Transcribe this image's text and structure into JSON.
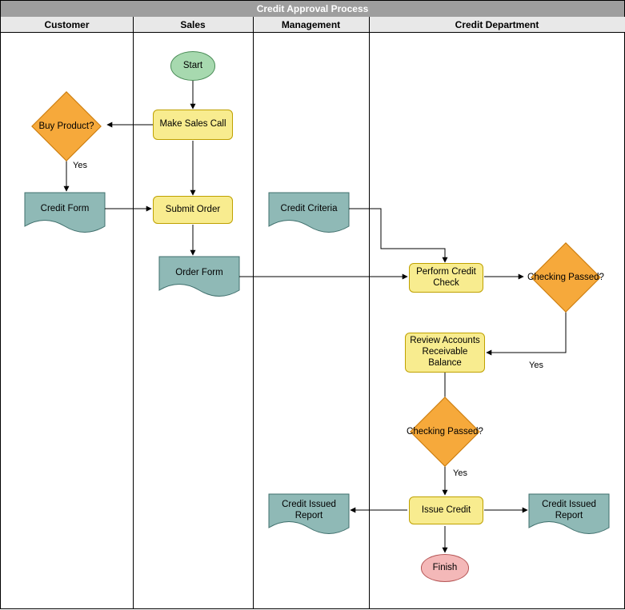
{
  "title": "Credit Approval Process",
  "lanes": {
    "customer": "Customer",
    "sales": "Sales",
    "management": "Management",
    "credit": "Credit Department"
  },
  "nodes": {
    "start": "Start",
    "make_sales_call": "Make Sales Call",
    "buy_product": "Buy Product?",
    "credit_form": "Credit Form",
    "submit_order": "Submit Order",
    "order_form": "Order Form",
    "credit_criteria": "Credit Criteria",
    "perform_credit_check": "Perform Credit Check",
    "checking_passed_1": "Checking Passed?",
    "review_ar_balance": "Review Accounts Receivable Balance",
    "checking_passed_2": "Checking Passed?",
    "issue_credit": "Issue Credit",
    "credit_issued_report_l": "Credit Issued Report",
    "credit_issued_report_r": "Credit Issued Report",
    "finish": "Finish"
  },
  "edge_labels": {
    "buy_yes": "Yes",
    "cp1_yes": "Yes",
    "cp2_yes": "Yes"
  },
  "colors": {
    "title_bg": "#9e9e9e",
    "lane_header_bg": "#e8e8e8",
    "process_fill": "#f8ec8f",
    "process_stroke": "#bfa100",
    "decision_fill": "#f6a93b",
    "decision_stroke": "#c97a0a",
    "document_fill": "#8fb9b6",
    "document_stroke": "#3f6f6c",
    "start_fill": "#a7d9af",
    "start_stroke": "#4a8c57",
    "finish_fill": "#f4b8b8",
    "finish_stroke": "#b55555"
  },
  "chart_data": {
    "type": "flowchart-swimlane",
    "swimlanes": [
      "Customer",
      "Sales",
      "Management",
      "Credit Department"
    ],
    "nodes": [
      {
        "id": "start",
        "lane": "Sales",
        "type": "start",
        "label": "Start"
      },
      {
        "id": "make_sales_call",
        "lane": "Sales",
        "type": "process",
        "label": "Make Sales Call"
      },
      {
        "id": "buy_product",
        "lane": "Customer",
        "type": "decision",
        "label": "Buy Product?"
      },
      {
        "id": "credit_form",
        "lane": "Customer",
        "type": "document",
        "label": "Credit Form"
      },
      {
        "id": "submit_order",
        "lane": "Sales",
        "type": "process",
        "label": "Submit Order"
      },
      {
        "id": "order_form",
        "lane": "Sales",
        "type": "document",
        "label": "Order Form"
      },
      {
        "id": "credit_criteria",
        "lane": "Management",
        "type": "document",
        "label": "Credit Criteria"
      },
      {
        "id": "perform_credit_check",
        "lane": "Credit Department",
        "type": "process",
        "label": "Perform Credit Check"
      },
      {
        "id": "checking_passed_1",
        "lane": "Credit Department",
        "type": "decision",
        "label": "Checking Passed?"
      },
      {
        "id": "review_ar_balance",
        "lane": "Credit Department",
        "type": "process",
        "label": "Review Accounts Receivable Balance"
      },
      {
        "id": "checking_passed_2",
        "lane": "Credit Department",
        "type": "decision",
        "label": "Checking Passed?"
      },
      {
        "id": "issue_credit",
        "lane": "Credit Department",
        "type": "process",
        "label": "Issue Credit"
      },
      {
        "id": "credit_issued_report_l",
        "lane": "Management",
        "type": "document",
        "label": "Credit Issued Report"
      },
      {
        "id": "credit_issued_report_r",
        "lane": "Credit Department",
        "type": "document",
        "label": "Credit Issued Report"
      },
      {
        "id": "finish",
        "lane": "Credit Department",
        "type": "end",
        "label": "Finish"
      }
    ],
    "edges": [
      {
        "from": "start",
        "to": "make_sales_call"
      },
      {
        "from": "make_sales_call",
        "to": "buy_product"
      },
      {
        "from": "buy_product",
        "to": "credit_form",
        "label": "Yes"
      },
      {
        "from": "make_sales_call",
        "to": "submit_order"
      },
      {
        "from": "credit_form",
        "to": "submit_order"
      },
      {
        "from": "submit_order",
        "to": "order_form"
      },
      {
        "from": "order_form",
        "to": "perform_credit_check"
      },
      {
        "from": "credit_criteria",
        "to": "perform_credit_check"
      },
      {
        "from": "perform_credit_check",
        "to": "checking_passed_1"
      },
      {
        "from": "checking_passed_1",
        "to": "review_ar_balance",
        "label": "Yes"
      },
      {
        "from": "review_ar_balance",
        "to": "checking_passed_2"
      },
      {
        "from": "checking_passed_2",
        "to": "issue_credit",
        "label": "Yes"
      },
      {
        "from": "issue_credit",
        "to": "credit_issued_report_l"
      },
      {
        "from": "issue_credit",
        "to": "credit_issued_report_r"
      },
      {
        "from": "issue_credit",
        "to": "finish"
      }
    ]
  }
}
